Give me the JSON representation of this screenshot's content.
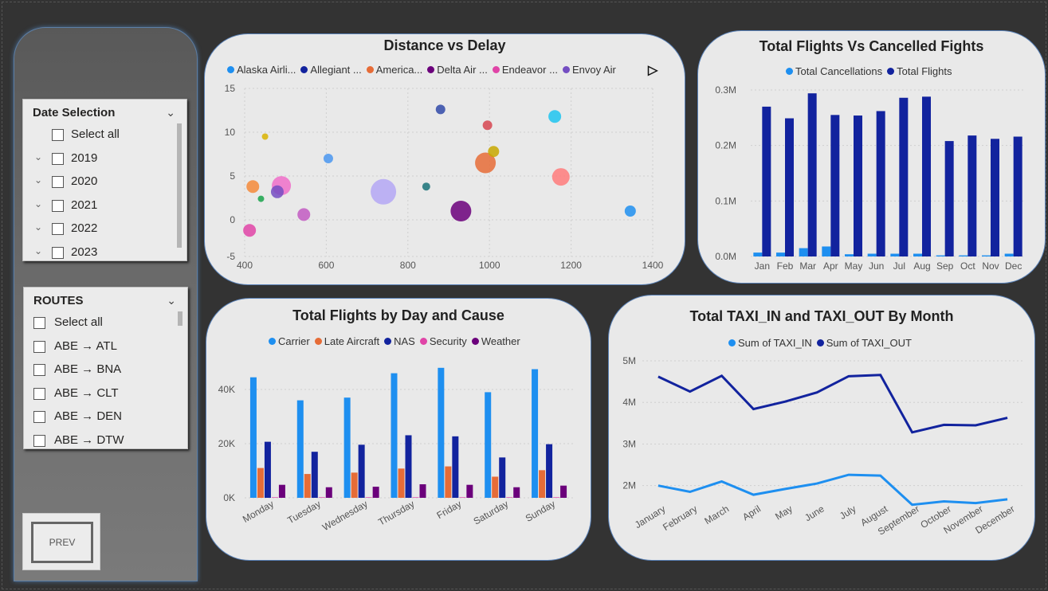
{
  "date_slicer": {
    "title": "Date Selection",
    "select_all": "Select all",
    "years": [
      "2019",
      "2020",
      "2021",
      "2022",
      "2023"
    ]
  },
  "routes_slicer": {
    "title": "ROUTES",
    "select_all": "Select all",
    "routes": [
      "ABE → ATL",
      "ABE → BNA",
      "ABE → CLT",
      "ABE → DEN",
      "ABE → DTW"
    ]
  },
  "prev_button": {
    "label": "PREV"
  },
  "colors": {
    "background": "#333333",
    "card": "#e9e9e9",
    "card_border": "#5a82b8",
    "light_blue": "#1e8ff0",
    "dark_blue": "#12239e",
    "orange": "#e66c37",
    "purple": "#6b007b",
    "pink": "#e044a7"
  },
  "scatter_legend": [
    {
      "label": "Alaska Airli...",
      "color": "#1e8ff0"
    },
    {
      "label": "Allegiant ...",
      "color": "#12239e"
    },
    {
      "label": "America...",
      "color": "#e66c37"
    },
    {
      "label": "Delta Air ...",
      "color": "#6b007b"
    },
    {
      "label": "Endeavor ...",
      "color": "#e044a7"
    },
    {
      "label": "Envoy Air",
      "color": "#744ec2"
    }
  ],
  "chart_data": [
    {
      "type": "scatter",
      "title": "Distance vs Delay",
      "xlim": [
        400,
        1400
      ],
      "ylim": [
        -4,
        15
      ],
      "xticks": [
        400,
        600,
        800,
        1000,
        1200,
        1400
      ],
      "yticks": [
        15,
        10,
        5,
        0,
        -5
      ],
      "points": [
        {
          "x": 420,
          "y": 3.8,
          "r": 8,
          "color": "#f58a3a"
        },
        {
          "x": 450,
          "y": 9.5,
          "r": 4,
          "color": "#d9b300"
        },
        {
          "x": 440,
          "y": 2.4,
          "r": 4,
          "color": "#17a34a"
        },
        {
          "x": 412,
          "y": -1.2,
          "r": 8,
          "color": "#e044a7"
        },
        {
          "x": 490,
          "y": 3.9,
          "r": 12,
          "color": "#f06ec9"
        },
        {
          "x": 480,
          "y": 3.2,
          "r": 8,
          "color": "#744ec2"
        },
        {
          "x": 545,
          "y": 0.6,
          "r": 8,
          "color": "#c25bc2"
        },
        {
          "x": 605,
          "y": 7.0,
          "r": 6,
          "color": "#4a96f0"
        },
        {
          "x": 740,
          "y": 3.2,
          "r": 16,
          "color": "#b4a7f5"
        },
        {
          "x": 845,
          "y": 3.8,
          "r": 5,
          "color": "#197278"
        },
        {
          "x": 880,
          "y": 12.6,
          "r": 6,
          "color": "#3049a8"
        },
        {
          "x": 930,
          "y": 1.0,
          "r": 13,
          "color": "#6b007b"
        },
        {
          "x": 990,
          "y": 6.5,
          "r": 13,
          "color": "#e66c37"
        },
        {
          "x": 995,
          "y": 10.8,
          "r": 6,
          "color": "#d64550"
        },
        {
          "x": 1010,
          "y": 7.8,
          "r": 7,
          "color": "#c8a800"
        },
        {
          "x": 1160,
          "y": 11.8,
          "r": 8,
          "color": "#1fc4f0"
        },
        {
          "x": 1175,
          "y": 4.9,
          "r": 11,
          "color": "#ff7b7b"
        },
        {
          "x": 1345,
          "y": 1.0,
          "r": 7,
          "color": "#1e8ff0"
        }
      ]
    },
    {
      "type": "bar",
      "title": "Total Flights Vs Cancelled Fights",
      "categories": [
        "Jan",
        "Feb",
        "Mar",
        "Apr",
        "May",
        "Jun",
        "Jul",
        "Aug",
        "Sep",
        "Oct",
        "Nov",
        "Dec"
      ],
      "series": [
        {
          "name": "Total Cancellations",
          "color": "#1e8ff0",
          "values": [
            7000,
            7000,
            15000,
            18000,
            4000,
            5000,
            5000,
            5000,
            2000,
            2000,
            2000,
            5000
          ]
        },
        {
          "name": "Total Flights",
          "color": "#12239e",
          "values": [
            270000,
            249000,
            294000,
            255000,
            254000,
            262000,
            286000,
            288000,
            208000,
            218000,
            212000,
            216000
          ]
        }
      ],
      "ylim": [
        0,
        300000
      ],
      "yticks": [
        {
          "v": 300000,
          "label": "0.3M"
        },
        {
          "v": 200000,
          "label": "0.2M"
        },
        {
          "v": 100000,
          "label": "0.1M"
        },
        {
          "v": 0,
          "label": "0.0M"
        }
      ]
    },
    {
      "type": "bar",
      "title": "Total Flights by Day and Cause",
      "categories": [
        "Monday",
        "Tuesday",
        "Wednesday",
        "Thursday",
        "Friday",
        "Saturday",
        "Sunday"
      ],
      "series": [
        {
          "name": "Carrier",
          "color": "#1e8ff0",
          "values": [
            44500,
            36000,
            37000,
            46000,
            48000,
            39000,
            47500
          ]
        },
        {
          "name": "Late Aircraft",
          "color": "#e66c37",
          "values": [
            11000,
            8800,
            9300,
            10800,
            11600,
            7800,
            10200
          ]
        },
        {
          "name": "NAS",
          "color": "#12239e",
          "values": [
            20700,
            17000,
            19600,
            23100,
            22700,
            14900,
            19800
          ]
        },
        {
          "name": "Security",
          "color": "#e044a7",
          "values": [
            200,
            200,
            200,
            200,
            200,
            200,
            200
          ]
        },
        {
          "name": "Weather",
          "color": "#6b007b",
          "values": [
            4800,
            3900,
            4100,
            5000,
            4800,
            3900,
            4500
          ]
        }
      ],
      "ylim": [
        0,
        50000
      ],
      "yticks": [
        {
          "v": 40000,
          "label": "40K"
        },
        {
          "v": 20000,
          "label": "20K"
        },
        {
          "v": 0,
          "label": "0K"
        }
      ]
    },
    {
      "type": "line",
      "title": "Total TAXI_IN and TAXI_OUT By Month",
      "categories": [
        "January",
        "February",
        "March",
        "April",
        "May",
        "June",
        "July",
        "August",
        "September",
        "October",
        "November",
        "December"
      ],
      "series": [
        {
          "name": "Sum of TAXI_IN",
          "color": "#1e8ff0",
          "values": [
            2000000,
            1850000,
            2100000,
            1780000,
            1920000,
            2050000,
            2260000,
            2240000,
            1540000,
            1620000,
            1580000,
            1670000
          ]
        },
        {
          "name": "Sum of TAXI_OUT",
          "color": "#12239e",
          "values": [
            4620000,
            4260000,
            4640000,
            3840000,
            4020000,
            4240000,
            4630000,
            4660000,
            3280000,
            3460000,
            3450000,
            3630000
          ]
        }
      ],
      "ylim": [
        1400000,
        5000000
      ],
      "yticks": [
        {
          "v": 5000000,
          "label": "5M"
        },
        {
          "v": 4000000,
          "label": "4M"
        },
        {
          "v": 3000000,
          "label": "3M"
        },
        {
          "v": 2000000,
          "label": "2M"
        }
      ]
    }
  ]
}
